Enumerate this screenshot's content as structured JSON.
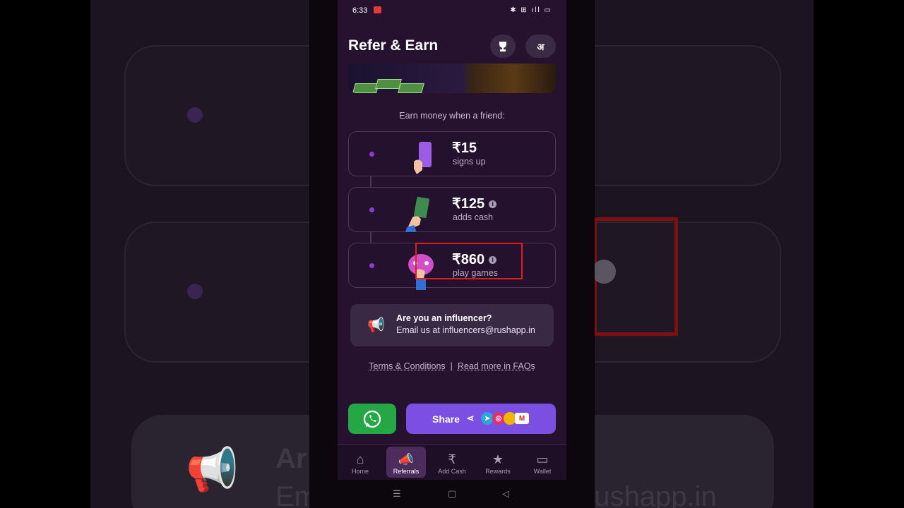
{
  "status": {
    "time": "6:33",
    "icons": "✱ ⊞ ıll ▭"
  },
  "header": {
    "title": "Refer & Earn",
    "lang_icon_label": "अ"
  },
  "earn": {
    "caption": "Earn money when a friend:",
    "steps": [
      {
        "amount": "₹15",
        "desc": "signs up",
        "info": false
      },
      {
        "amount": "₹125",
        "desc": "adds cash",
        "info": true
      },
      {
        "amount": "₹860",
        "desc": "play games",
        "info": true
      }
    ]
  },
  "influencer": {
    "title": "Are you an influencer?",
    "email": "Email us at influencers@rushapp.in"
  },
  "links": {
    "terms": "Terms & Conditions",
    "sep": "|",
    "faq": "Read more in FAQs"
  },
  "share": {
    "label": "Share"
  },
  "nav": [
    {
      "label": "Home",
      "icon": "home-icon"
    },
    {
      "label": "Referrals",
      "icon": "megaphone-icon"
    },
    {
      "label": "Add Cash",
      "icon": "rupee-plus-icon"
    },
    {
      "label": "Rewards",
      "icon": "calendar-star-icon"
    },
    {
      "label": "Wallet",
      "icon": "wallet-icon"
    }
  ],
  "background": {
    "text1": "Ar",
    "text2": "Em",
    "text3": "rushapp.in"
  },
  "colors": {
    "bg": "#26122f",
    "accent": "#7b4fe2",
    "whatsapp": "#25a745",
    "highlight": "#e01c1c"
  }
}
